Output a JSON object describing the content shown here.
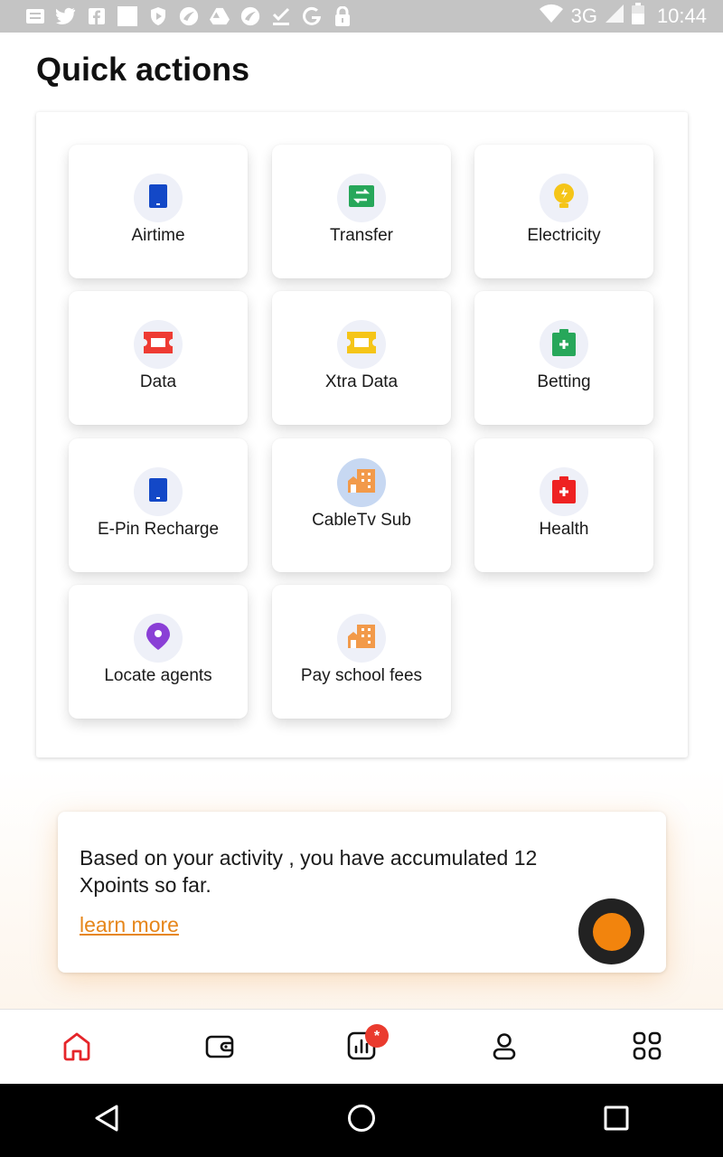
{
  "status_bar": {
    "network": "3G",
    "time": "10:44"
  },
  "page_title": "Quick actions",
  "tiles": [
    {
      "label": "Airtime",
      "icon": "phone-icon",
      "color": "#1348c7"
    },
    {
      "label": "Transfer",
      "icon": "transfer-icon",
      "color": "#27a75a"
    },
    {
      "label": "Electricity",
      "icon": "bulb-icon",
      "color": "#f5c518"
    },
    {
      "label": "Data",
      "icon": "ticket-icon",
      "color": "#ee3b33"
    },
    {
      "label": "Xtra Data",
      "icon": "ticket-icon",
      "color": "#f5c518"
    },
    {
      "label": "Betting",
      "icon": "medkit-icon",
      "color": "#27a75a"
    },
    {
      "label": "E-Pin Recharge",
      "icon": "phone-icon",
      "color": "#1348c7"
    },
    {
      "label": "CableTv Sub",
      "icon": "building-icon",
      "color": "#f29a4a"
    },
    {
      "label": "Health",
      "icon": "medkit-icon",
      "color": "#ee2222"
    },
    {
      "label": "Locate agents",
      "icon": "location-pin-icon",
      "color": "#8a3fd6"
    },
    {
      "label": "Pay school fees",
      "icon": "building-icon",
      "color": "#f29a4a"
    }
  ],
  "points": {
    "text": "Based on your activity , you have accumulated 12 Xpoints so far.",
    "link": "learn more"
  },
  "nav": {
    "badge": "*",
    "items": [
      "home-icon",
      "wallet-icon",
      "stats-icon",
      "profile-icon",
      "grid-menu-icon"
    ],
    "active_color": "#e5252a"
  }
}
